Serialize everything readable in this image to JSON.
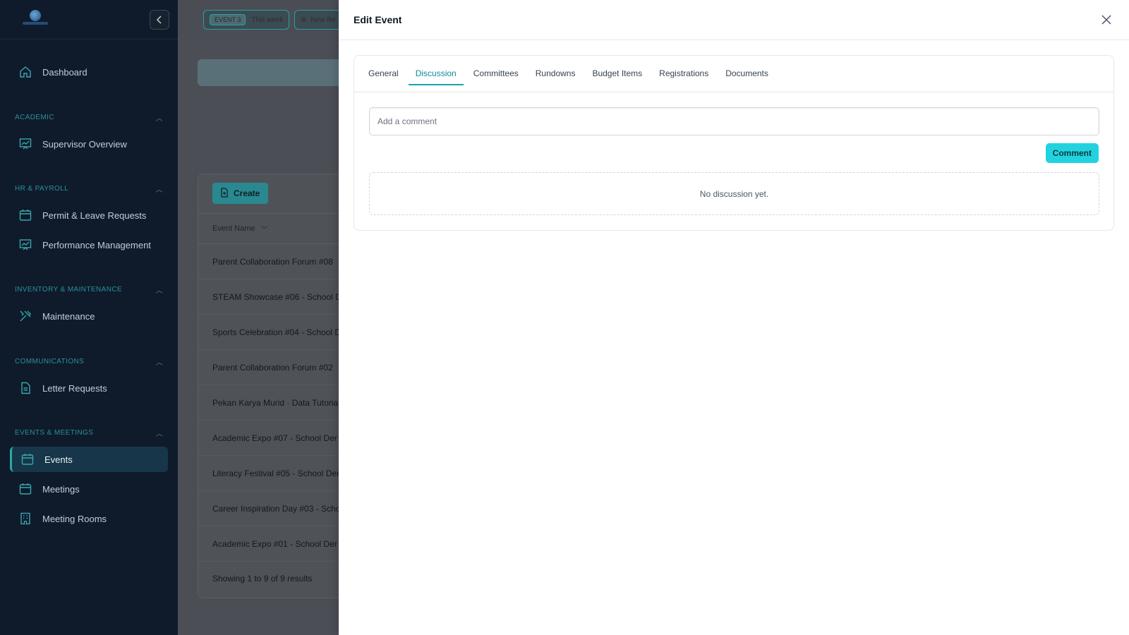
{
  "sidebar": {
    "items": {
      "dashboard": "Dashboard",
      "supervisor_overview": "Supervisor Overview",
      "permit_leave": "Permit & Leave Requests",
      "performance": "Performance Management",
      "maintenance": "Maintenance",
      "letter_requests": "Letter Requests",
      "events": "Events",
      "meetings": "Meetings",
      "meeting_rooms": "Meeting Rooms"
    },
    "sections": {
      "academic": "ACADEMIC",
      "hr_payroll": "HR & PAYROLL",
      "inventory": "INVENTORY & MAINTENANCE",
      "communications": "COMMUNICATIONS",
      "events_meetings": "EVENTS & MEETINGS"
    }
  },
  "topbar": {
    "chip_tag": "EVENT 3",
    "chip_label": "This week",
    "new_chip": "New Re"
  },
  "events_table": {
    "create_label": "Create",
    "column_event_name": "Event Name",
    "rows": [
      "Parent Collaboration Forum #08",
      "STEAM Showcase #06 - School D",
      "Sports Celebration #04 - School D",
      "Parent Collaboration Forum #02",
      "Pekan Karya Murid · Data Tutoria",
      "Academic Expo #07 - School Der",
      "Literacy Festival #05 - School Der",
      "Career Inspiration Day #03 - Scho",
      "Academic Expo #01 - School Der"
    ],
    "footer": "Showing 1 to 9 of 9 results"
  },
  "drawer": {
    "title": "Edit Event",
    "tabs": {
      "general": "General",
      "discussion": "Discussion",
      "committees": "Committees",
      "rundowns": "Rundowns",
      "budget_items": "Budget Items",
      "registrations": "Registrations",
      "documents": "Documents"
    },
    "comment_placeholder": "Add a comment",
    "comment_button": "Comment",
    "empty_text": "No discussion yet."
  },
  "colors": {
    "sidebar_bg": "#0f1b2a",
    "accent": "#18a3ae",
    "comment_button": "#22d3df"
  }
}
